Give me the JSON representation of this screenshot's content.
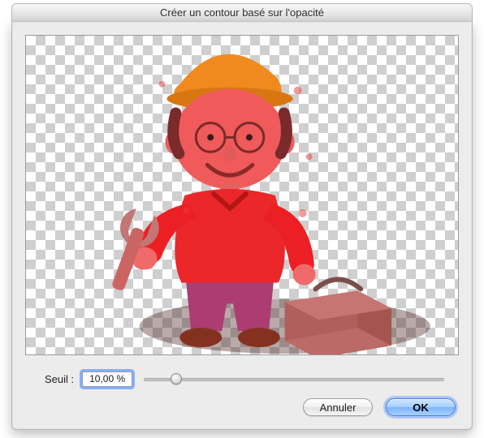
{
  "dialog": {
    "title": "Créer un contour basé sur l'opacité"
  },
  "threshold": {
    "label": "Seuil :",
    "value": "10,00 %",
    "slider_percent": 10
  },
  "buttons": {
    "cancel": "Annuler",
    "ok": "OK"
  },
  "palette": {
    "helmet": "#f08a1e",
    "skin": "#f56b6b",
    "shirt": "#ec2024",
    "pants": "#8c3c8f",
    "shoes": "#5a2f14",
    "toolbox": "#a97f7a",
    "wrench": "#c27676",
    "tint": "#e83b3b",
    "shadow": "rgba(70,30,30,0.38)"
  }
}
